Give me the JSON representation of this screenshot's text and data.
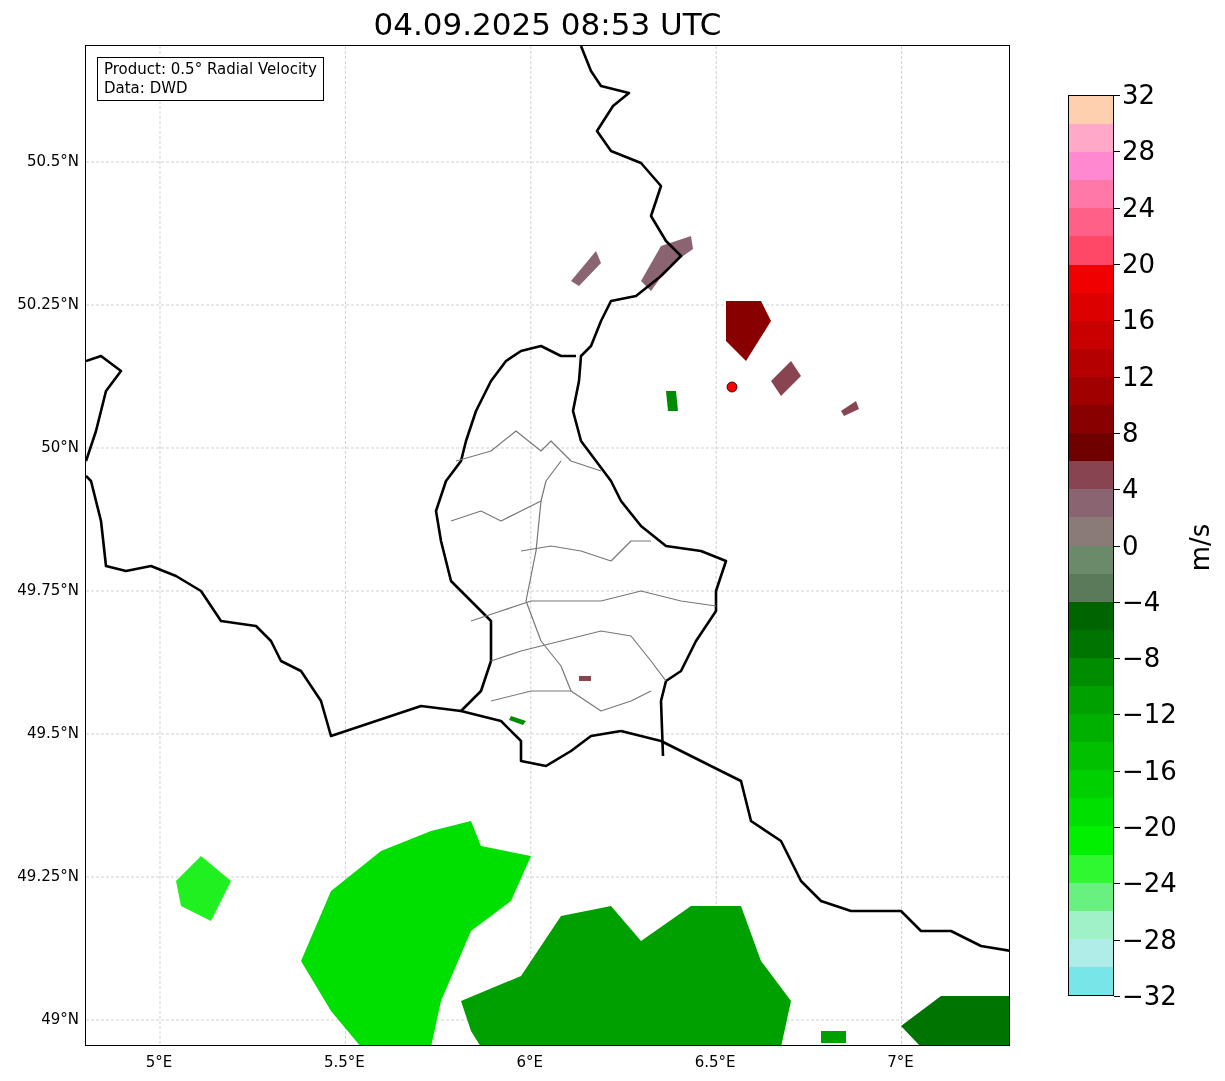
{
  "title": "04.09.2025 08:53 UTC",
  "map": {
    "info_box": [
      "Product: 0.5° Radial Velocity",
      "Data: DWD"
    ],
    "x_ticks": [
      "5°E",
      "5.5°E",
      "6°E",
      "6.5°E",
      "7°E"
    ],
    "y_ticks": [
      "50.5°N",
      "50.25°N",
      "50°N",
      "49.75°N",
      "49.5°N",
      "49.25°N",
      "49°N"
    ]
  },
  "colorbar": {
    "label": "m/s",
    "ticks": [
      "32",
      "28",
      "24",
      "20",
      "16",
      "12",
      "8",
      "4",
      "0",
      "−4",
      "−8",
      "−12",
      "−16",
      "−20",
      "−24",
      "−28",
      "−32"
    ],
    "bins": [
      {
        "color": "#ffd0b0"
      },
      {
        "color": "#ffa8c8"
      },
      {
        "color": "#ff88d0"
      },
      {
        "color": "#ff78a8"
      },
      {
        "color": "#ff6088"
      },
      {
        "color": "#ff4868"
      },
      {
        "color": "#f00000"
      },
      {
        "color": "#dc0000"
      },
      {
        "color": "#c80000"
      },
      {
        "color": "#b40000"
      },
      {
        "color": "#a00000"
      },
      {
        "color": "#880000"
      },
      {
        "color": "#700000"
      },
      {
        "color": "#884450"
      },
      {
        "color": "#8a6470"
      },
      {
        "color": "#8a7a78"
      },
      {
        "color": "#6a8a6a"
      },
      {
        "color": "#5a7a5a"
      },
      {
        "color": "#006400"
      },
      {
        "color": "#007400"
      },
      {
        "color": "#008c00"
      },
      {
        "color": "#00a000"
      },
      {
        "color": "#00b000"
      },
      {
        "color": "#00c000"
      },
      {
        "color": "#00d000"
      },
      {
        "color": "#00e000"
      },
      {
        "color": "#00f000"
      },
      {
        "color": "#30f830"
      },
      {
        "color": "#68f080"
      },
      {
        "color": "#a0f0c8"
      },
      {
        "color": "#b0ece8"
      },
      {
        "color": "#78e6e8"
      }
    ]
  }
}
